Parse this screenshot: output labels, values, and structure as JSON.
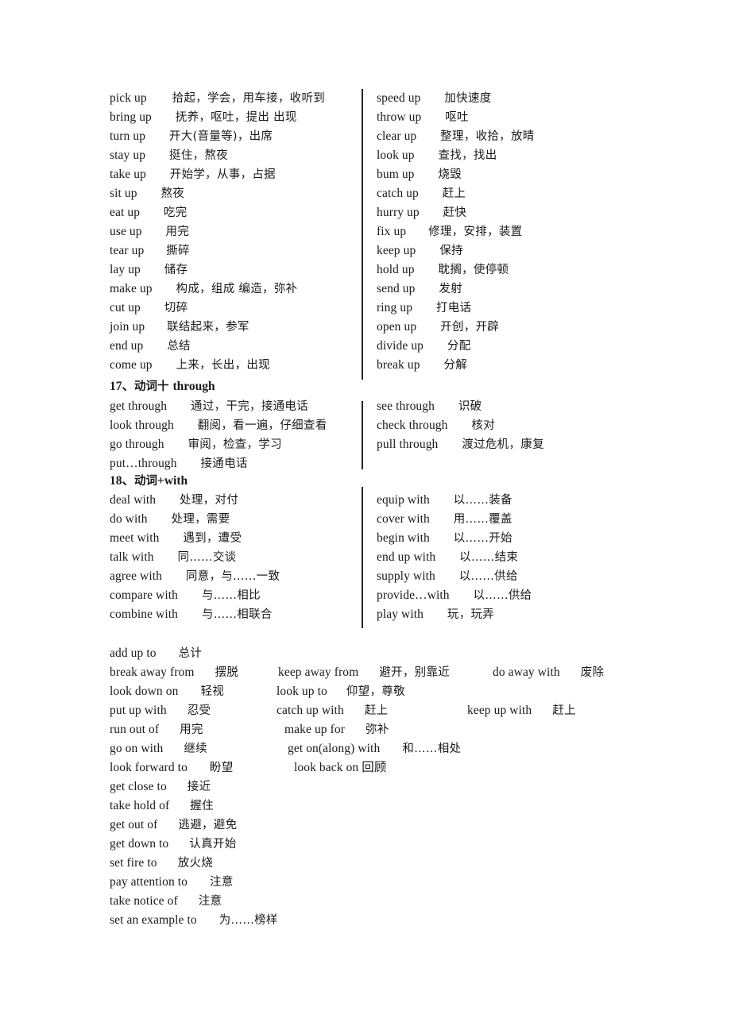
{
  "document": {
    "sections": [
      {
        "id": "verb-up",
        "heading": null,
        "left_column": [
          {
            "en": "pick up",
            "cn": "拾起，学会，用车接，收听到"
          },
          {
            "en": "bring up",
            "cn": "抚养，呕吐，提出 出现"
          },
          {
            "en": "turn up",
            "cn": "开大(音量等)，出席"
          },
          {
            "en": "stay up",
            "cn": "挺住，熬夜"
          },
          {
            "en": "take up",
            "cn": "开始学，从事，占据"
          },
          {
            "en": "sit up",
            "cn": "熬夜"
          },
          {
            "en": "eat up",
            "cn": "吃完"
          },
          {
            "en": "use up",
            "cn": "用完"
          },
          {
            "en": "tear up",
            "cn": "撕碎"
          },
          {
            "en": "lay up",
            "cn": "储存"
          },
          {
            "en": "make up",
            "cn": "构成，组成 编造，弥补"
          },
          {
            "en": "cut up",
            "cn": "切碎"
          },
          {
            "en": "join up",
            "cn": "联结起来，参军"
          },
          {
            "en": "end up",
            "cn": "总结"
          },
          {
            "en": "come up",
            "cn": "上来，长出，出现"
          }
        ],
        "right_column": [
          {
            "en": "speed up",
            "cn": "加快速度"
          },
          {
            "en": "throw up",
            "cn": "呕吐"
          },
          {
            "en": "clear up",
            "cn": "整理，收拾，放晴"
          },
          {
            "en": "look up",
            "cn": "查找，找出"
          },
          {
            "en": "bum up",
            "cn": "烧毁"
          },
          {
            "en": "catch up",
            "cn": "赶上"
          },
          {
            "en": "hurry up",
            "cn": "赶快"
          },
          {
            "en": "fix up",
            "cn": "修理，安排，装置"
          },
          {
            "en": "keep up",
            "cn": "保持"
          },
          {
            "en": "hold up",
            "cn": "耽搁，使停顿"
          },
          {
            "en": "send up",
            "cn": "发射"
          },
          {
            "en": "ring up",
            "cn": "打电话"
          },
          {
            "en": "open up",
            "cn": "开创，开辟"
          },
          {
            "en": "divide up",
            "cn": "分配"
          },
          {
            "en": "break up",
            "cn": "分解"
          }
        ]
      },
      {
        "id": "verb-through",
        "heading": {
          "num": "17、",
          "cn": "动词十",
          "en": "through"
        },
        "left_column": [
          {
            "en": "get through",
            "cn": "通过，干完，接通电话"
          },
          {
            "en": "look through",
            "cn": "翻阅，看一遍，仔细查看"
          },
          {
            "en": "go through",
            "cn": "审阅，检查，学习"
          },
          {
            "en": "put…through",
            "cn": "接通电话"
          }
        ],
        "right_column": [
          {
            "en": "see through",
            "cn": "识破"
          },
          {
            "en": "check through",
            "cn": "核对"
          },
          {
            "en": "pull through",
            "cn": "渡过危机，康复"
          }
        ]
      },
      {
        "id": "verb-with",
        "heading": {
          "num": "18、",
          "cn": "动词",
          "en": "+with"
        },
        "left_column": [
          {
            "en": "deal with",
            "cn": "处理，对付"
          },
          {
            "en": "do with",
            "cn": "处理，需要"
          },
          {
            "en": "meet with",
            "cn": "遇到，遭受"
          },
          {
            "en": "talk with",
            "cn": "同……交谈"
          },
          {
            "en": "agree with",
            "cn": "同意，与……一致"
          },
          {
            "en": "compare with",
            "cn": "与……相比"
          },
          {
            "en": "combine with",
            "cn": "与……相联合"
          }
        ],
        "right_column": [
          {
            "en": "equip with",
            "cn": "以……装备"
          },
          {
            "en": "cover with",
            "cn": "用……覆盖"
          },
          {
            "en": "begin with",
            "cn": "以……开始"
          },
          {
            "en": "end up with",
            "cn": "以……结束"
          },
          {
            "en": "supply with",
            "cn": "以……供给"
          },
          {
            "en": "provide…with",
            "cn": "以……供给"
          },
          {
            "en": "play with",
            "cn": "玩，玩弄"
          }
        ]
      }
    ],
    "bottom_block": {
      "rows": [
        {
          "c1": {
            "en": "add up to",
            "cn": "总计"
          },
          "c2": null,
          "c3": null
        },
        {
          "c1": {
            "en": "break away from",
            "cn": "摆脱"
          },
          "c2": {
            "en": "keep away from",
            "cn": "避开，别靠近"
          },
          "c3": {
            "en": "do away with",
            "cn": "废除"
          }
        },
        {
          "c1": {
            "en": "look down on",
            "cn": "轻视"
          },
          "c2": {
            "en": "look up to",
            "cn": "仰望，尊敬"
          },
          "c3": null
        },
        {
          "c1": {
            "en": "put up with",
            "cn": "忍受"
          },
          "c2": {
            "en": "catch up with",
            "cn": "赶上"
          },
          "c3": {
            "en": "keep up with",
            "cn": "赶上"
          }
        },
        {
          "c1": {
            "en": "run out of",
            "cn": "用完"
          },
          "c2": {
            "en": "make up for",
            "cn": "弥补"
          },
          "c3": null
        },
        {
          "c1": {
            "en": "go on with",
            "cn": "继续"
          },
          "c2": {
            "en": "get on(along) with",
            "cn": "和……相处"
          },
          "c3": null
        },
        {
          "c1": {
            "en": "look forward to",
            "cn": "盼望"
          },
          "c2": {
            "en": "look back on 回顾",
            "cn": ""
          },
          "c3": null
        },
        {
          "c1": {
            "en": "get close to",
            "cn": "接近"
          },
          "c2": null,
          "c3": null
        },
        {
          "c1": {
            "en": "take hold of",
            "cn": "握住"
          },
          "c2": null,
          "c3": null
        },
        {
          "c1": {
            "en": "get out of",
            "cn": "逃避，避免"
          },
          "c2": null,
          "c3": null
        },
        {
          "c1": {
            "en": "get down to",
            "cn": "认真开始"
          },
          "c2": null,
          "c3": null
        },
        {
          "c1": {
            "en": "set fire to",
            "cn": "放火烧"
          },
          "c2": null,
          "c3": null
        },
        {
          "c1": {
            "en": "pay attention to",
            "cn": "注意"
          },
          "c2": null,
          "c3": null
        },
        {
          "c1": {
            "en": "take notice of",
            "cn": "注意"
          },
          "c2": null,
          "c3": null
        },
        {
          "c1": {
            "en": "set an example to",
            "cn": "为……榜样"
          },
          "c2": null,
          "c3": null
        }
      ]
    },
    "colors": {
      "text": "#1a1a1a",
      "rule": "#232323",
      "background": "#ffffff"
    }
  }
}
